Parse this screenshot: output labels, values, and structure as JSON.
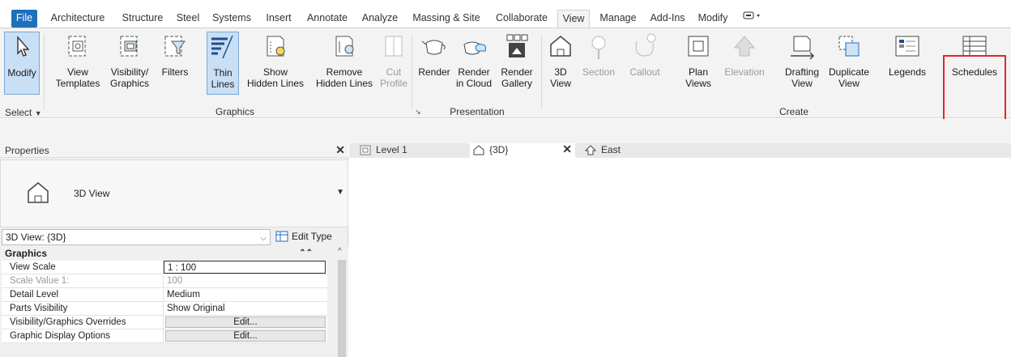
{
  "menu": {
    "tabs": [
      "File",
      "Architecture",
      "Structure",
      "Steel",
      "Systems",
      "Insert",
      "Annotate",
      "Analyze",
      "Massing & Site",
      "Collaborate",
      "View",
      "Manage",
      "Add-Ins",
      "Modify"
    ],
    "active": "View"
  },
  "ribbon": {
    "modify": "Modify",
    "select": "Select",
    "view_templates": "View\nTemplates",
    "visibility_graphics": "Visibility/\nGraphics",
    "filters": "Filters",
    "thin_lines": "Thin\nLines",
    "show_hidden": "Show\nHidden Lines",
    "remove_hidden": "Remove\nHidden Lines",
    "cut_profile": "Cut\nProfile",
    "render": "Render",
    "render_cloud": "Render\nin Cloud",
    "render_gallery": "Render\nGallery",
    "view_3d": "3D\nView",
    "section": "Section",
    "callout": "Callout",
    "plan_views": "Plan\nViews",
    "elevation": "Elevation",
    "drafting_view": "Drafting\nView",
    "duplicate_view": "Duplicate\nView",
    "legends": "Legends",
    "schedules": "Schedules",
    "panel_graphics": "Graphics",
    "panel_presentation": "Presentation",
    "panel_create": "Create"
  },
  "properties": {
    "title": "Properties",
    "type_name": "3D View",
    "instance_selector": "3D View: {3D}",
    "edit_type": "Edit Type",
    "group": "Graphics",
    "rows": [
      {
        "k": "View Scale",
        "v": "1 : 100"
      },
      {
        "k": "Scale Value    1:",
        "v": "100"
      },
      {
        "k": "Detail Level",
        "v": "Medium"
      },
      {
        "k": "Parts Visibility",
        "v": "Show Original"
      },
      {
        "k": "Visibility/Graphics Overrides",
        "v": "Edit..."
      },
      {
        "k": "Graphic Display Options",
        "v": "Edit..."
      }
    ]
  },
  "view_tabs": {
    "level1": "Level 1",
    "view3d": "{3D}",
    "east": "East"
  },
  "colors": {
    "highlight": "#e0262b",
    "file_tab": "#1f6fbf",
    "selected_btn": "#c9dff5"
  }
}
